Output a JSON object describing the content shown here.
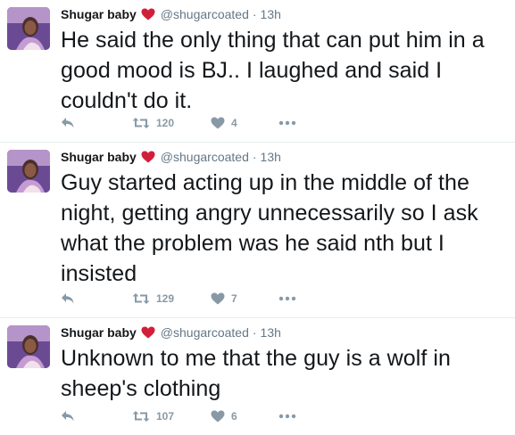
{
  "colors": {
    "heart": "#e0245e",
    "name": "#14171a",
    "meta": "#657786",
    "action": "#8899a6",
    "divider": "#e6ecf0"
  },
  "icons": {
    "reply": "reply-arrow-icon",
    "retweet": "retweet-icon",
    "like": "heart-outline-icon",
    "more": "more-dots-icon",
    "name_badge": "red-heart-icon"
  },
  "tweets": [
    {
      "name": "Shugar baby",
      "handle": "@shugarcoated",
      "dot": "·",
      "time": "13h",
      "text": "He said the only thing that can put him in a good mood is BJ.. I laughed and said I couldn't do it.",
      "retweets": "120",
      "likes": "4"
    },
    {
      "name": "Shugar baby",
      "handle": "@shugarcoated",
      "dot": "·",
      "time": "13h",
      "text": "Guy started acting up in the middle of the night, getting angry unnecessarily so I ask what the problem was he said nth but I insisted",
      "retweets": "129",
      "likes": "7"
    },
    {
      "name": "Shugar baby",
      "handle": "@shugarcoated",
      "dot": "·",
      "time": "13h",
      "text": "Unknown to me that the guy is a wolf in sheep's clothing",
      "retweets": "107",
      "likes": "6"
    }
  ]
}
